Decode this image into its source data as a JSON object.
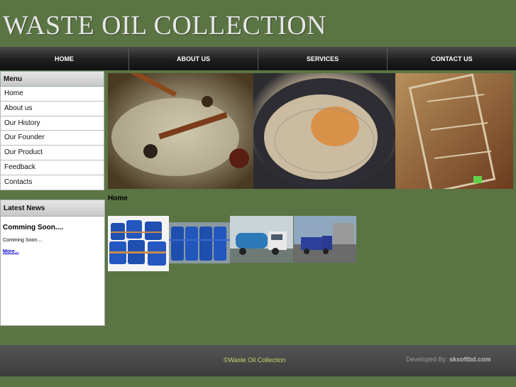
{
  "site": {
    "title": "WASTE OIL COLLECTION"
  },
  "nav": {
    "items": [
      "HOME",
      "ABOUT US",
      "SERVICES",
      "CONTACT US"
    ]
  },
  "sidebar": {
    "menu_title": "Menu",
    "items": [
      "Home",
      "About us",
      "Our History",
      "Our Founder",
      "Our Product",
      "Feedback",
      "Contacts"
    ]
  },
  "news": {
    "title": "Latest News",
    "headline": "Comming Soon....",
    "body": "Comming Soon....",
    "more": "More..."
  },
  "main": {
    "breadcrumb": "Home"
  },
  "footer": {
    "copyright": "©Waste Oil Collection",
    "developed_label": "Developed By:",
    "developer": "sksoftbd.com"
  },
  "colors": {
    "background": "#5b7444",
    "nav": "#1e1e1e",
    "footer": "#444444",
    "copyright": "#c8d46a"
  }
}
